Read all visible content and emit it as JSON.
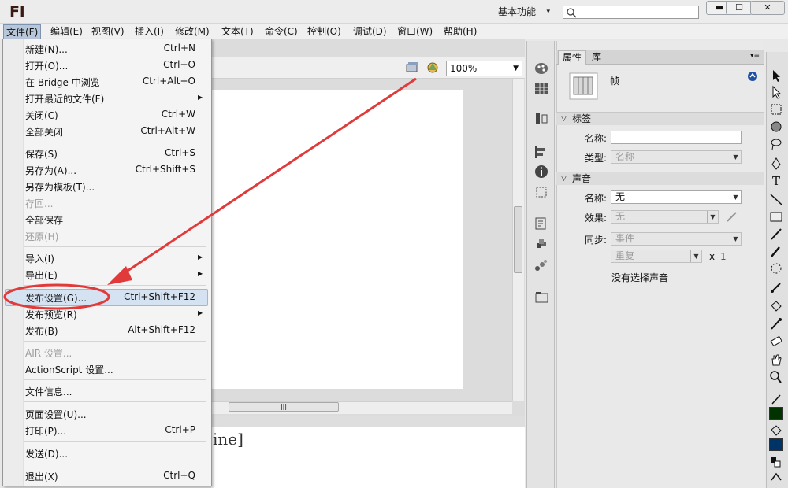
{
  "app": {
    "logo": "Fl",
    "workspace": "基本功能",
    "search_placeholder": ""
  },
  "window_buttons": {
    "minimize": "▬",
    "maximize": "☐",
    "close": "✕"
  },
  "menubar": [
    {
      "id": "file",
      "label": "文件(F)"
    },
    {
      "id": "edit",
      "label": "编辑(E)"
    },
    {
      "id": "view",
      "label": "视图(V)"
    },
    {
      "id": "insert",
      "label": "插入(I)"
    },
    {
      "id": "modify",
      "label": "修改(M)"
    },
    {
      "id": "text",
      "label": "文本(T)"
    },
    {
      "id": "commands",
      "label": "命令(C)"
    },
    {
      "id": "control",
      "label": "控制(O)"
    },
    {
      "id": "debug",
      "label": "调试(D)"
    },
    {
      "id": "window",
      "label": "窗口(W)"
    },
    {
      "id": "help",
      "label": "帮助(H)"
    }
  ],
  "file_menu": {
    "items": [
      {
        "label": "新建(N)...",
        "shortcut": "Ctrl+N"
      },
      {
        "label": "打开(O)...",
        "shortcut": "Ctrl+O"
      },
      {
        "label": "在 Bridge 中浏览",
        "shortcut": "Ctrl+Alt+O"
      },
      {
        "label": "打开最近的文件(F)",
        "shortcut": ""
      },
      {
        "label": "关闭(C)",
        "shortcut": "Ctrl+W"
      },
      {
        "label": "全部关闭",
        "shortcut": "Ctrl+Alt+W"
      },
      {
        "label": "保存(S)",
        "shortcut": "Ctrl+S"
      },
      {
        "label": "另存为(A)...",
        "shortcut": "Ctrl+Shift+S"
      },
      {
        "label": "另存为模板(T)...",
        "shortcut": ""
      },
      {
        "label": "存回...",
        "shortcut": ""
      },
      {
        "label": "全部保存",
        "shortcut": ""
      },
      {
        "label": "还原(H)",
        "shortcut": ""
      },
      {
        "label": "导入(I)",
        "shortcut": ""
      },
      {
        "label": "导出(E)",
        "shortcut": ""
      },
      {
        "label": "发布设置(G)...",
        "shortcut": "Ctrl+Shift+F12"
      },
      {
        "label": "发布预览(R)",
        "shortcut": ""
      },
      {
        "label": "发布(B)",
        "shortcut": "Alt+Shift+F12"
      },
      {
        "label": "AIR 设置...",
        "shortcut": ""
      },
      {
        "label": "ActionScript 设置...",
        "shortcut": ""
      },
      {
        "label": "文件信息...",
        "shortcut": ""
      },
      {
        "label": "页面设置(U)...",
        "shortcut": ""
      },
      {
        "label": "打印(P)...",
        "shortcut": "Ctrl+P"
      },
      {
        "label": "发送(D)...",
        "shortcut": ""
      },
      {
        "label": "退出(X)",
        "shortcut": "Ctrl+Q"
      }
    ]
  },
  "stage": {
    "zoom": "100%",
    "timeline_text": "ine]"
  },
  "properties": {
    "tabs": [
      "属性",
      "库"
    ],
    "frame_label": "帧",
    "label_section": "标签",
    "name_label": "名称:",
    "name_value": "",
    "type_label": "类型:",
    "type_value": "名称",
    "sound_section": "声音",
    "sound_name_label": "名称:",
    "sound_name_value": "无",
    "effect_label": "效果:",
    "effect_value": "无",
    "sync_label": "同步:",
    "sync_value": "事件",
    "repeat_value": "重复",
    "repeat_x": "x",
    "repeat_count": "1",
    "no_sound": "没有选择声音"
  },
  "colors": {
    "stroke_color": "#003300",
    "fill_color": "#003366",
    "annotation": "#e03a3a"
  }
}
